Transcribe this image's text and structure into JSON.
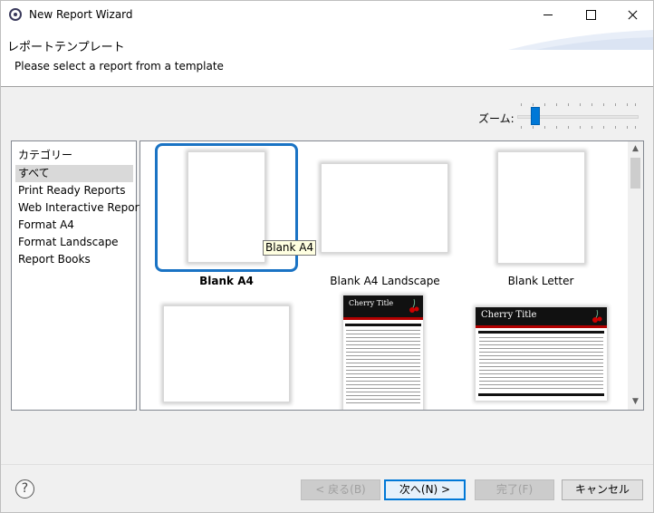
{
  "window": {
    "title": "New Report Wizard"
  },
  "header": {
    "title": "レポートテンプレート",
    "description": "Please select a report from a template"
  },
  "zoom": {
    "label": "ズーム:",
    "value_fraction": 0.12
  },
  "categories": {
    "heading": "カテゴリー",
    "items": [
      {
        "label": "すべて",
        "selected": true
      },
      {
        "label": "Print Ready Reports",
        "selected": false
      },
      {
        "label": "Web Interactive Reports",
        "selected": false
      },
      {
        "label": "Format A4",
        "selected": false
      },
      {
        "label": "Format Landscape",
        "selected": false
      },
      {
        "label": "Report Books",
        "selected": false
      }
    ]
  },
  "templates": [
    {
      "label": "Blank A4",
      "selected": true
    },
    {
      "label": "Blank A4 Landscape",
      "selected": false
    },
    {
      "label": "Blank Letter",
      "selected": false
    }
  ],
  "tooltip": "Blank A4",
  "cherry_thumbnails": {
    "title": "Cherry Title"
  },
  "buttons": {
    "back": "< 戻る(B)",
    "next": "次へ(N) >",
    "finish": "完了(F)",
    "cancel": "キャンセル"
  },
  "help": {
    "symbol": "?"
  },
  "colors": {
    "accent": "#0078d7",
    "selection_frame": "#1a73c4",
    "cherry_red": "#b30000"
  }
}
